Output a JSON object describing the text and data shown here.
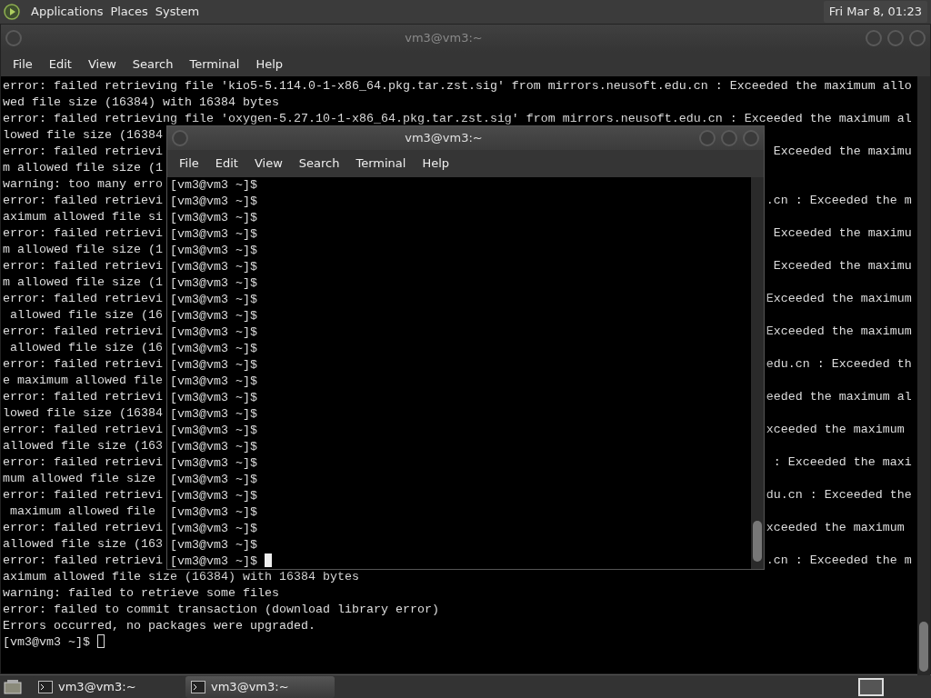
{
  "top_panel": {
    "menus": [
      "Applications",
      "Places",
      "System"
    ],
    "clock": "Fri Mar 8, 01:23"
  },
  "back_window": {
    "title": "vm3@vm3:~",
    "menu": [
      "File",
      "Edit",
      "View",
      "Search",
      "Terminal",
      "Help"
    ],
    "lines": [
      {
        "left": "error: failed retrieving file 'kio5-5.114.0-1-x86_64.pkg.tar.zst.sig' from mirrors.neusoft.edu.cn : Exceeded the maximum allo"
      },
      {
        "left": "wed file size (16384) with 16384 bytes"
      },
      {
        "left": "error: failed retrieving file 'oxygen-5.27.10-1-x86_64.pkg.tar.zst.sig' from mirrors.neusoft.edu.cn : Exceeded the maximum al"
      },
      {
        "left": "lowed file size (16384"
      },
      {
        "left": "error: failed retrievi",
        "right": " Exceeded the maximu"
      },
      {
        "left": "m allowed file size (1"
      },
      {
        "left": "warning: too many erro"
      },
      {
        "left": "error: failed retrievi",
        "right": ".cn : Exceeded the m"
      },
      {
        "left": "aximum allowed file si"
      },
      {
        "left": "error: failed retrievi",
        "right": " Exceeded the maximu"
      },
      {
        "left": "m allowed file size (1"
      },
      {
        "left": "error: failed retrievi",
        "right": " Exceeded the maximu"
      },
      {
        "left": "m allowed file size (1"
      },
      {
        "left": "error: failed retrievi",
        "right": "Exceeded the maximum"
      },
      {
        "left": " allowed file size (16"
      },
      {
        "left": "error: failed retrievi",
        "right": "Exceeded the maximum"
      },
      {
        "left": " allowed file size (16"
      },
      {
        "left": "error: failed retrievi",
        "right": "edu.cn : Exceeded th"
      },
      {
        "left": "e maximum allowed file"
      },
      {
        "left": "error: failed retrievi",
        "right": "eeded the maximum al"
      },
      {
        "left": "lowed file size (16384"
      },
      {
        "left": "error: failed retrievi",
        "right": "xceeded the maximum"
      },
      {
        "left": "allowed file size (163"
      },
      {
        "left": "error: failed retrievi",
        "right": " : Exceeded the maxi"
      },
      {
        "left": "mum allowed file size"
      },
      {
        "left": "error: failed retrievi",
        "right": "du.cn : Exceeded the"
      },
      {
        "left": " maximum allowed file"
      },
      {
        "left": "error: failed retrievi",
        "right": "xceeded the maximum"
      },
      {
        "left": "allowed file size (163"
      },
      {
        "left": "error: failed retrievi",
        "right": ".cn : Exceeded the m"
      },
      {
        "left": "aximum allowed file size (16384) with 16384 bytes"
      },
      {
        "left": "warning: failed to retrieve some files"
      },
      {
        "left": "error: failed to commit transaction (download library error)"
      },
      {
        "left": "Errors occurred, no packages were upgraded."
      }
    ],
    "prompt": "[vm3@vm3 ~]$"
  },
  "front_window": {
    "title": "vm3@vm3:~",
    "menu": [
      "File",
      "Edit",
      "View",
      "Search",
      "Terminal",
      "Help"
    ],
    "lines": [
      "[vm3@vm3 ~]$",
      "[vm3@vm3 ~]$",
      "[vm3@vm3 ~]$",
      "[vm3@vm3 ~]$",
      "[vm3@vm3 ~]$",
      "[vm3@vm3 ~]$",
      "[vm3@vm3 ~]$",
      "[vm3@vm3 ~]$",
      "[vm3@vm3 ~]$",
      "[vm3@vm3 ~]$",
      "[vm3@vm3 ~]$",
      "[vm3@vm3 ~]$",
      "[vm3@vm3 ~]$",
      "[vm3@vm3 ~]$",
      "[vm3@vm3 ~]$",
      "[vm3@vm3 ~]$",
      "[vm3@vm3 ~]$",
      "[vm3@vm3 ~]$",
      "[vm3@vm3 ~]$",
      "[vm3@vm3 ~]$",
      "[vm3@vm3 ~]$",
      "[vm3@vm3 ~]$",
      "[vm3@vm3 ~]$",
      "[vm3@vm3 ~]$"
    ]
  },
  "taskbar": {
    "tasks": [
      {
        "label": "vm3@vm3:~",
        "selected": false
      },
      {
        "label": "vm3@vm3:~",
        "selected": true
      }
    ]
  }
}
